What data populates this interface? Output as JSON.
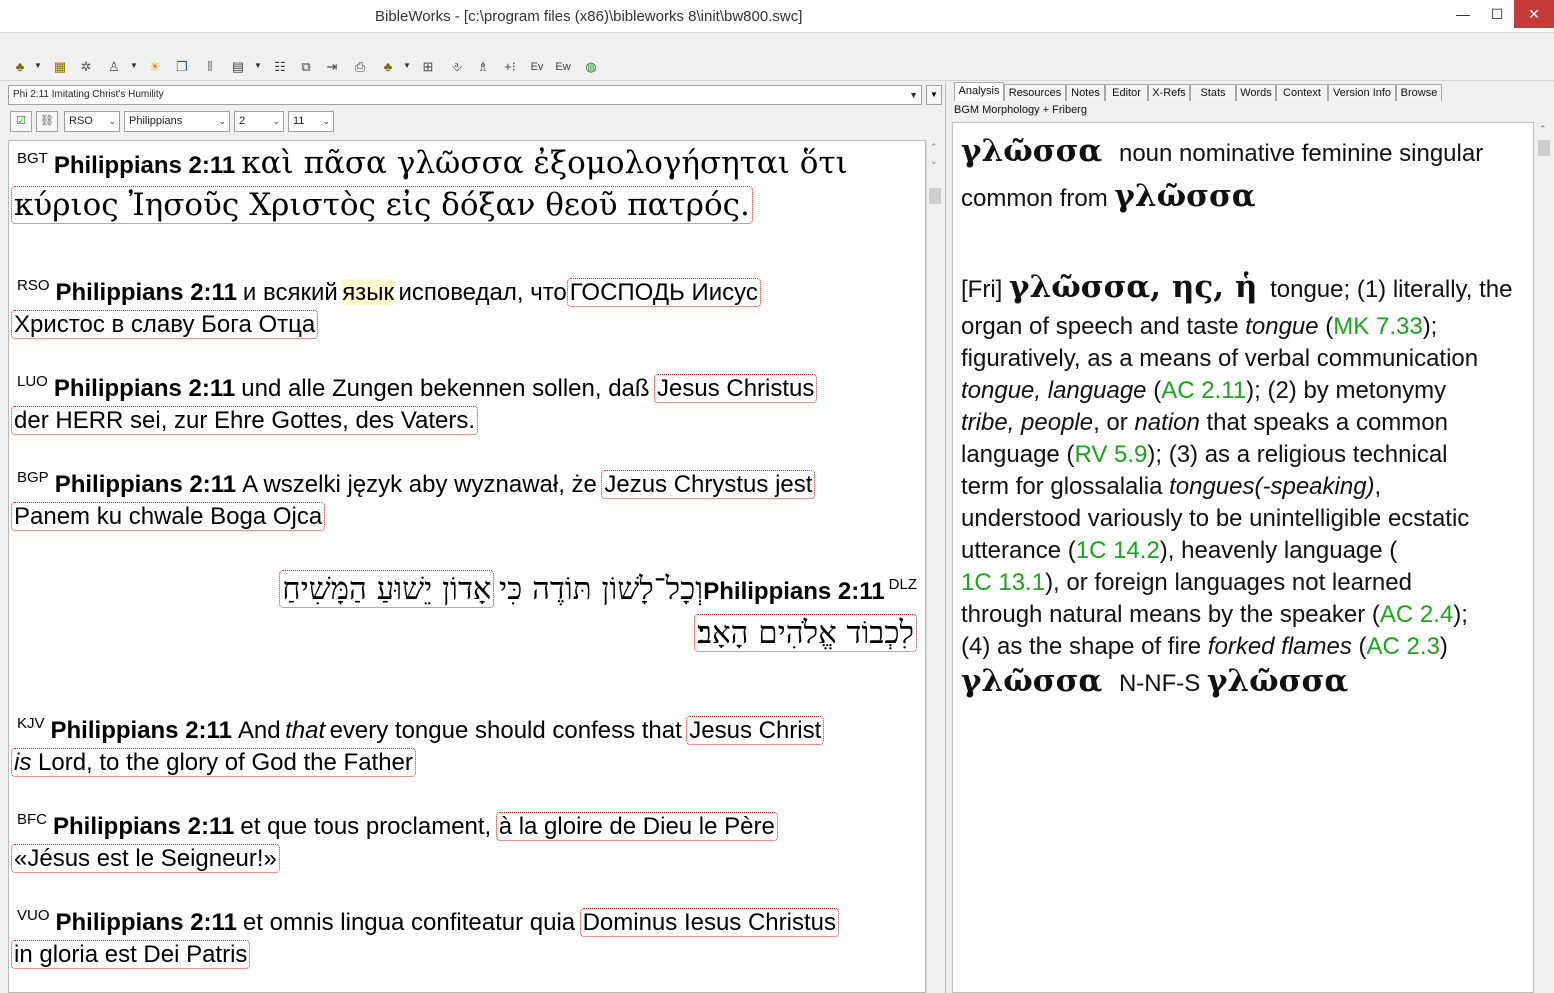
{
  "window": {
    "title": "BibleWorks - [c:\\program files (x86)\\bibleworks 8\\init\\bw800.swc]",
    "minimize": "—",
    "maximize": "☐",
    "close": "✕"
  },
  "toolbar": {
    "icons": [
      "search-icon",
      "options-icon",
      "tools-icon",
      "user-icon",
      "sun-icon",
      "windows-icon",
      "columns-icon",
      "grid-icon",
      "list-icon",
      "copy-icon",
      "export-icon",
      "print-icon",
      "tools2-icon",
      "browse-icon",
      "report-icon",
      "person-icon",
      "plus-icon",
      "ev-icon",
      "ew-icon",
      "globe-icon"
    ]
  },
  "left": {
    "verse_title": "Phi 2:11 Imitating Christ's Humility",
    "version_combo": "RSO",
    "book_combo": "Philippians",
    "chapter_combo": "2",
    "verse_combo": "11",
    "verses": {
      "bgt": {
        "version": "BGT",
        "ref": "Philippians 2:11",
        "line1": "καὶ πᾶσα γλῶσσα ἐξομολογήσηται ὅτι",
        "line2": "κύριος Ἰησοῦς Χριστὸς εἰς δόξαν θεοῦ πατρός."
      },
      "rso": {
        "version": "RSO",
        "ref": "Philippians 2:11",
        "pre": "и всякий",
        "hl": "язык",
        "mid": "исповедал, что",
        "box1": "ГОСПОДЬ Иисус",
        "box2": "Христос в славу Бога Отца"
      },
      "luo": {
        "version": "LUO",
        "ref": "Philippians 2:11",
        "pre": "und alle Zungen bekennen sollen, daß",
        "box1": "Jesus Christus",
        "box2": "der HERR sei, zur Ehre Gottes, des Vaters."
      },
      "bgp": {
        "version": "BGP",
        "ref": "Philippians 2:11",
        "pre": "A wszelki język aby wyznawał, że",
        "box1": "Jezus Chrystus jest",
        "box2": "Panem ku chwale Boga Ojca"
      },
      "dlz": {
        "version": "DLZ",
        "ref": "Philippians 2:11",
        "pre": "וְכָל־לָשׁוֹן תּוֹדֶה כִּי",
        "box1": "אָדוֹן יֵשׁוּעַ הַמָּשִׁיחַ",
        "box2": "לִכְבוֹד אֱלֹהִים הָאָב׃"
      },
      "kjv": {
        "version": "KJV",
        "ref": "Philippians 2:11",
        "pre1": "And",
        "ital1": "that",
        "pre2": "every tongue should confess that",
        "box1": "Jesus Christ",
        "ital2": "is",
        "box2": "Lord, to the glory of God the Father"
      },
      "bfc": {
        "version": "BFC",
        "ref": "Philippians 2:11",
        "pre": "et que tous proclament,",
        "box1": "à la gloire de Dieu le Père",
        "box2": "«Jésus est le Seigneur!»"
      },
      "vuo": {
        "version": "VUO",
        "ref": "Philippians 2:11",
        "pre": "et omnis lingua confiteatur quia",
        "box1": "Dominus Iesus Christus",
        "box2": "in gloria est Dei Patris"
      }
    }
  },
  "right": {
    "tabs": [
      "Analysis",
      "Resources",
      "Notes",
      "Editor",
      "X-Refs",
      "Stats",
      "Words",
      "Context",
      "Version Info",
      "Browse"
    ],
    "module": "BGM Morphology + Friberg",
    "analysis": {
      "head_word": "γλῶσσα",
      "head_desc": "noun nominative feminine singular",
      "head_line2_pre": "common from",
      "head_lemma": "γλῶσσα",
      "fri_tag": "[Fri]",
      "fri_lemma": "γλῶσσα, ης, ἡ",
      "fri_l1": "tongue; (1) literally, the",
      "fri_l2_pre": "organ of speech and taste",
      "fri_l2_ital": "tongue",
      "fri_l2_open": "(",
      "fri_l2_ref": "MK 7.33",
      "fri_l2_post": ");",
      "fri_l3": "figuratively, as a means of verbal communication",
      "fri_l4_ital": "tongue, language",
      "fri_l4_open": "(",
      "fri_l4_ref": "AC 2.11",
      "fri_l4_post": "); (2) by metonymy",
      "fri_l5_i1": "tribe, people",
      "fri_l5_mid": ", or",
      "fri_l5_i2": "nation",
      "fri_l5_post": "that speaks a common",
      "fri_l6_pre": "language (",
      "fri_l6_ref": "RV 5.9",
      "fri_l6_post": "); (3) as a religious technical",
      "fri_l7_pre": "term for glossalalia",
      "fri_l7_ital": "tongues(-speaking)",
      "fri_l7_post": ",",
      "fri_l8": "understood variously to be unintelligible ecstatic",
      "fri_l9_pre": "utterance (",
      "fri_l9_ref": "1C 14.2",
      "fri_l9_post": "), heavenly language (",
      "fri_l10_ref": "1C 13.1",
      "fri_l10_post": "), or foreign languages not learned",
      "fri_l11_pre": "through natural means by the speaker (",
      "fri_l11_ref": "AC 2.4",
      "fri_l11_post": ");",
      "fri_l12_pre": "(4) as the shape of fire",
      "fri_l12_ital": "forked flames",
      "fri_l12_open": "(",
      "fri_l12_ref": "AC 2.3",
      "fri_l12_post": ")",
      "parse_word": "γλῶσσα",
      "parse_code": "N-NF-S",
      "parse_lemma": "γλῶσσα"
    }
  }
}
